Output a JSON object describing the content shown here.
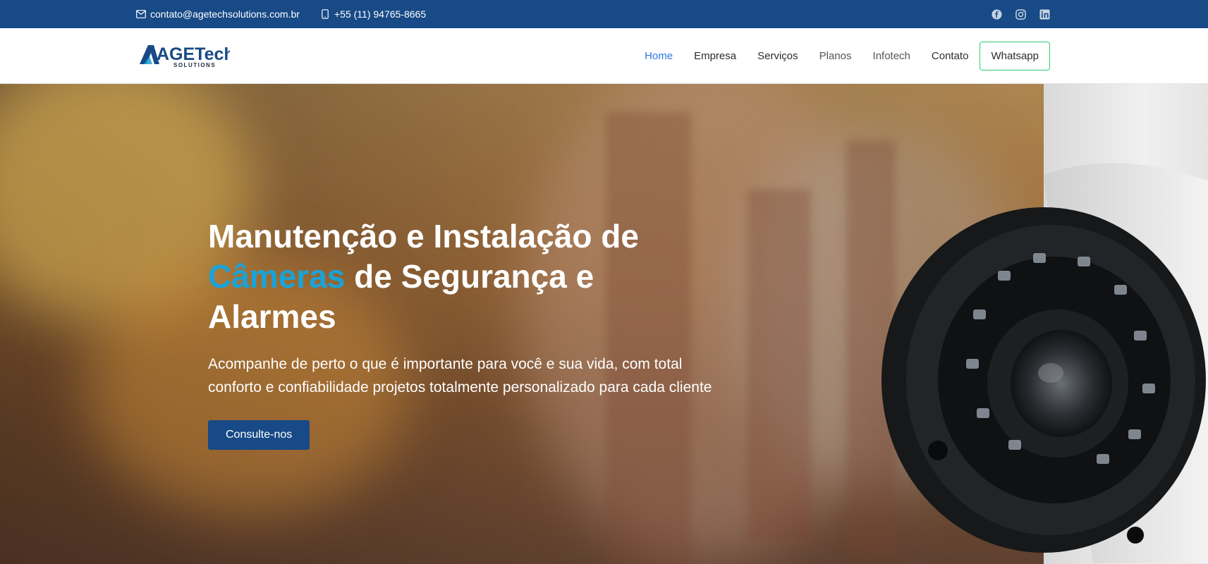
{
  "topbar": {
    "email": "contato@agetechsolutions.com.br",
    "phone": "+55 (11) 94765-8665",
    "social": [
      "facebook-icon",
      "instagram-icon",
      "linkedin-icon"
    ]
  },
  "header": {
    "logo_text": "AGETech",
    "logo_sub": "SOLUTIONS",
    "nav": [
      {
        "label": "Home"
      },
      {
        "label": "Empresa"
      },
      {
        "label": "Serviços"
      },
      {
        "label": "Planos"
      },
      {
        "label": "Infotech"
      },
      {
        "label": "Contato"
      }
    ],
    "whatsapp_label": "Whatsapp"
  },
  "hero": {
    "title_part1": "Manutenção e Instalação de",
    "title_accent": "Câmeras",
    "title_part2": "de Segurança e Alarmes",
    "subtitle": "Acompanhe de perto o que é importante para você e sua vida, com total conforto e confiabilidade projetos totalmente personalizado para cada cliente",
    "cta_label": "Consulte-nos"
  },
  "colors": {
    "topbar": "#174a86",
    "accent": "#1aa3d8",
    "nav_active": "#2a7ae2",
    "whatsapp_border": "#2ecc71",
    "cta_bg": "#174a86"
  }
}
